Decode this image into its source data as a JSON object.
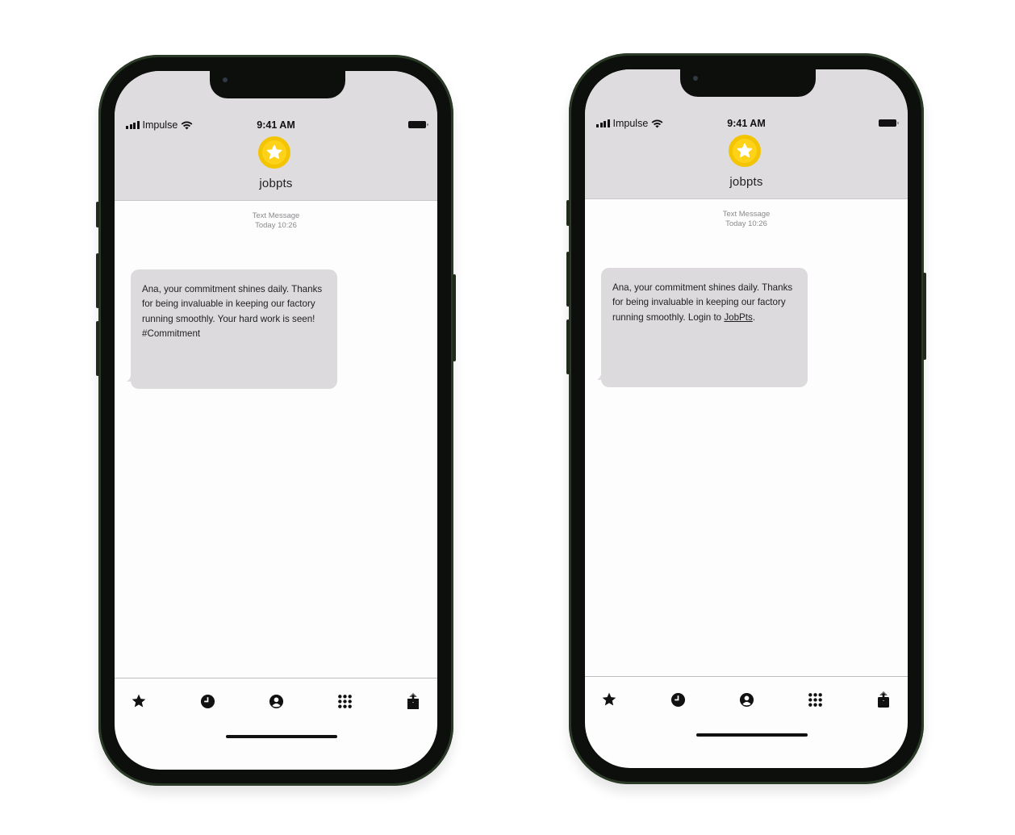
{
  "phones": [
    {
      "status": {
        "carrier": "Impulse",
        "time": "9:41 AM"
      },
      "contact": {
        "name": "jobpts"
      },
      "meta": {
        "type": "Text Message",
        "timestamp": "Today 10:26"
      },
      "message": {
        "text": "Ana, your commitment shines daily. Thanks for being invaluable in keeping our factory running smoothly. Your hard work is seen! #Commitment",
        "link": ""
      },
      "tabs": [
        "star-icon",
        "clock-icon",
        "contact-icon",
        "keypad-icon",
        "share-icon"
      ]
    },
    {
      "status": {
        "carrier": "Impulse",
        "time": "9:41 AM"
      },
      "contact": {
        "name": "jobpts"
      },
      "meta": {
        "type": "Text Message",
        "timestamp": "Today 10:26"
      },
      "message": {
        "text": "Ana, your commitment shines daily. Thanks for being invaluable in keeping our factory running smoothly. Login to ",
        "link": "JobPts",
        "after": "."
      },
      "tabs": [
        "star-icon",
        "clock-icon",
        "contact-icon",
        "keypad-icon",
        "share-icon"
      ]
    }
  ],
  "colors": {
    "header_bg": "#dedcdf",
    "bubble_bg": "#dcdadd",
    "avatar": "#f3c400",
    "frame": "#0d0f0c"
  }
}
